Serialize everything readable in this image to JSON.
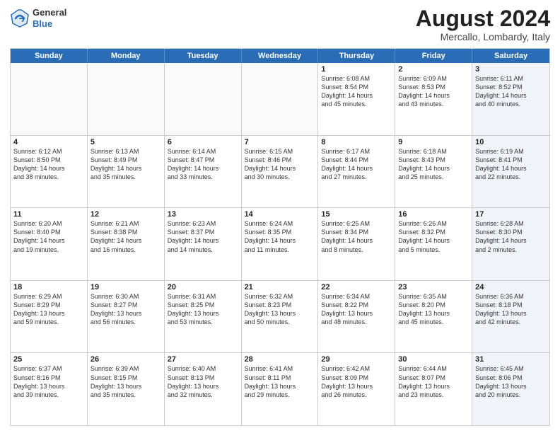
{
  "header": {
    "logo": {
      "line1": "General",
      "line2": "Blue"
    },
    "title": "August 2024",
    "location": "Mercallo, Lombardy, Italy"
  },
  "calendar": {
    "days_of_week": [
      "Sunday",
      "Monday",
      "Tuesday",
      "Wednesday",
      "Thursday",
      "Friday",
      "Saturday"
    ],
    "weeks": [
      [
        {
          "day": "",
          "info": "",
          "empty": true
        },
        {
          "day": "",
          "info": "",
          "empty": true
        },
        {
          "day": "",
          "info": "",
          "empty": true
        },
        {
          "day": "",
          "info": "",
          "empty": true
        },
        {
          "day": "1",
          "info": "Sunrise: 6:08 AM\nSunset: 8:54 PM\nDaylight: 14 hours\nand 45 minutes.",
          "empty": false
        },
        {
          "day": "2",
          "info": "Sunrise: 6:09 AM\nSunset: 8:53 PM\nDaylight: 14 hours\nand 43 minutes.",
          "empty": false
        },
        {
          "day": "3",
          "info": "Sunrise: 6:11 AM\nSunset: 8:52 PM\nDaylight: 14 hours\nand 40 minutes.",
          "empty": false,
          "shaded": true
        }
      ],
      [
        {
          "day": "4",
          "info": "Sunrise: 6:12 AM\nSunset: 8:50 PM\nDaylight: 14 hours\nand 38 minutes.",
          "empty": false
        },
        {
          "day": "5",
          "info": "Sunrise: 6:13 AM\nSunset: 8:49 PM\nDaylight: 14 hours\nand 35 minutes.",
          "empty": false
        },
        {
          "day": "6",
          "info": "Sunrise: 6:14 AM\nSunset: 8:47 PM\nDaylight: 14 hours\nand 33 minutes.",
          "empty": false
        },
        {
          "day": "7",
          "info": "Sunrise: 6:15 AM\nSunset: 8:46 PM\nDaylight: 14 hours\nand 30 minutes.",
          "empty": false
        },
        {
          "day": "8",
          "info": "Sunrise: 6:17 AM\nSunset: 8:44 PM\nDaylight: 14 hours\nand 27 minutes.",
          "empty": false
        },
        {
          "day": "9",
          "info": "Sunrise: 6:18 AM\nSunset: 8:43 PM\nDaylight: 14 hours\nand 25 minutes.",
          "empty": false
        },
        {
          "day": "10",
          "info": "Sunrise: 6:19 AM\nSunset: 8:41 PM\nDaylight: 14 hours\nand 22 minutes.",
          "empty": false,
          "shaded": true
        }
      ],
      [
        {
          "day": "11",
          "info": "Sunrise: 6:20 AM\nSunset: 8:40 PM\nDaylight: 14 hours\nand 19 minutes.",
          "empty": false
        },
        {
          "day": "12",
          "info": "Sunrise: 6:21 AM\nSunset: 8:38 PM\nDaylight: 14 hours\nand 16 minutes.",
          "empty": false
        },
        {
          "day": "13",
          "info": "Sunrise: 6:23 AM\nSunset: 8:37 PM\nDaylight: 14 hours\nand 14 minutes.",
          "empty": false
        },
        {
          "day": "14",
          "info": "Sunrise: 6:24 AM\nSunset: 8:35 PM\nDaylight: 14 hours\nand 11 minutes.",
          "empty": false
        },
        {
          "day": "15",
          "info": "Sunrise: 6:25 AM\nSunset: 8:34 PM\nDaylight: 14 hours\nand 8 minutes.",
          "empty": false
        },
        {
          "day": "16",
          "info": "Sunrise: 6:26 AM\nSunset: 8:32 PM\nDaylight: 14 hours\nand 5 minutes.",
          "empty": false
        },
        {
          "day": "17",
          "info": "Sunrise: 6:28 AM\nSunset: 8:30 PM\nDaylight: 14 hours\nand 2 minutes.",
          "empty": false,
          "shaded": true
        }
      ],
      [
        {
          "day": "18",
          "info": "Sunrise: 6:29 AM\nSunset: 8:29 PM\nDaylight: 13 hours\nand 59 minutes.",
          "empty": false
        },
        {
          "day": "19",
          "info": "Sunrise: 6:30 AM\nSunset: 8:27 PM\nDaylight: 13 hours\nand 56 minutes.",
          "empty": false
        },
        {
          "day": "20",
          "info": "Sunrise: 6:31 AM\nSunset: 8:25 PM\nDaylight: 13 hours\nand 53 minutes.",
          "empty": false
        },
        {
          "day": "21",
          "info": "Sunrise: 6:32 AM\nSunset: 8:23 PM\nDaylight: 13 hours\nand 50 minutes.",
          "empty": false
        },
        {
          "day": "22",
          "info": "Sunrise: 6:34 AM\nSunset: 8:22 PM\nDaylight: 13 hours\nand 48 minutes.",
          "empty": false
        },
        {
          "day": "23",
          "info": "Sunrise: 6:35 AM\nSunset: 8:20 PM\nDaylight: 13 hours\nand 45 minutes.",
          "empty": false
        },
        {
          "day": "24",
          "info": "Sunrise: 6:36 AM\nSunset: 8:18 PM\nDaylight: 13 hours\nand 42 minutes.",
          "empty": false,
          "shaded": true
        }
      ],
      [
        {
          "day": "25",
          "info": "Sunrise: 6:37 AM\nSunset: 8:16 PM\nDaylight: 13 hours\nand 39 minutes.",
          "empty": false
        },
        {
          "day": "26",
          "info": "Sunrise: 6:39 AM\nSunset: 8:15 PM\nDaylight: 13 hours\nand 35 minutes.",
          "empty": false
        },
        {
          "day": "27",
          "info": "Sunrise: 6:40 AM\nSunset: 8:13 PM\nDaylight: 13 hours\nand 32 minutes.",
          "empty": false
        },
        {
          "day": "28",
          "info": "Sunrise: 6:41 AM\nSunset: 8:11 PM\nDaylight: 13 hours\nand 29 minutes.",
          "empty": false
        },
        {
          "day": "29",
          "info": "Sunrise: 6:42 AM\nSunset: 8:09 PM\nDaylight: 13 hours\nand 26 minutes.",
          "empty": false
        },
        {
          "day": "30",
          "info": "Sunrise: 6:44 AM\nSunset: 8:07 PM\nDaylight: 13 hours\nand 23 minutes.",
          "empty": false
        },
        {
          "day": "31",
          "info": "Sunrise: 6:45 AM\nSunset: 8:06 PM\nDaylight: 13 hours\nand 20 minutes.",
          "empty": false,
          "shaded": true
        }
      ]
    ]
  }
}
